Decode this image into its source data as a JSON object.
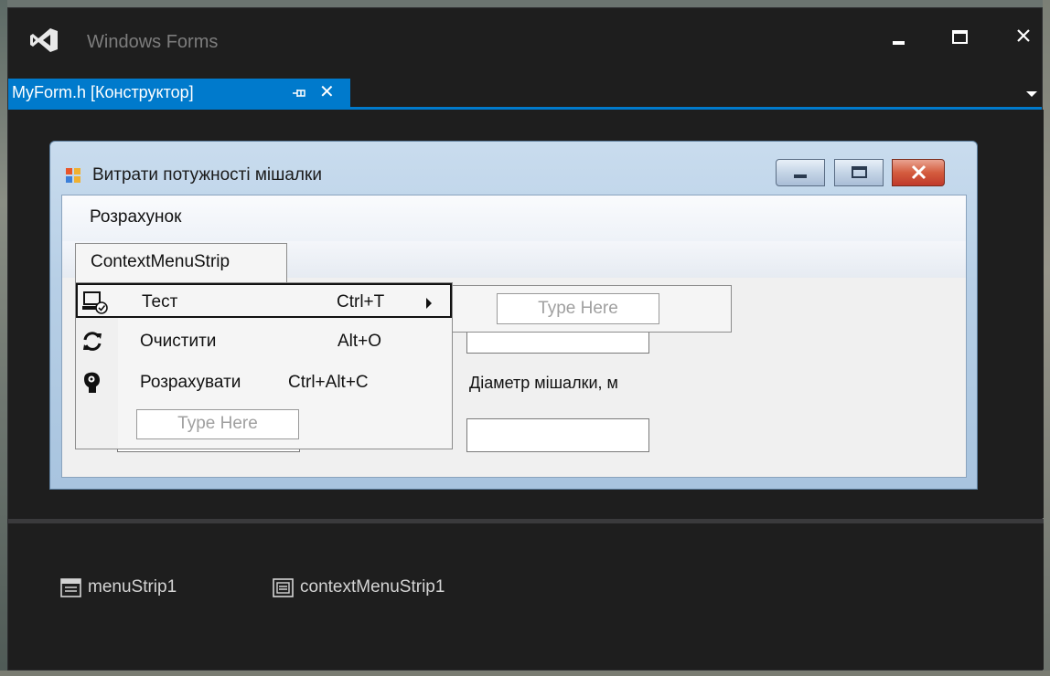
{
  "window": {
    "title": "Windows Forms"
  },
  "tabs": [
    {
      "label": "MyForm.h [Конструктор]",
      "active": true,
      "pin_icon": "pin-icon",
      "close_glyph": "✕"
    }
  ],
  "form": {
    "title": "Витрати потужності мішалки",
    "menu": {
      "items": [
        {
          "label": "Розрахунок"
        }
      ]
    },
    "context_menu_strip": {
      "tab_label": "ContextMenuStrip",
      "items": [
        {
          "label": "Тест",
          "shortcut": "Ctrl+T",
          "icon": "computer-check-icon",
          "has_submenu": true,
          "selected": true
        },
        {
          "label": "Очистити",
          "shortcut": "Alt+O",
          "icon": "refresh-icon",
          "has_submenu": false,
          "selected": false
        },
        {
          "label": "Розрахувати",
          "shortcut": "Ctrl+Alt+C",
          "icon": "head-gear-icon",
          "has_submenu": false,
          "selected": false
        }
      ],
      "type_here": "Type Here"
    },
    "submenu": {
      "type_here": "Type Here"
    },
    "labels": {
      "diameter": "Діаметр мішалки, м"
    }
  },
  "component_tray": [
    {
      "label": "menuStrip1",
      "icon": "menustrip-icon"
    },
    {
      "label": "contextMenuStrip1",
      "icon": "contextmenustrip-icon"
    }
  ],
  "colors": {
    "accent": "#007acc",
    "ide_background": "#1e1e1e",
    "close_button": "#c0392b"
  }
}
